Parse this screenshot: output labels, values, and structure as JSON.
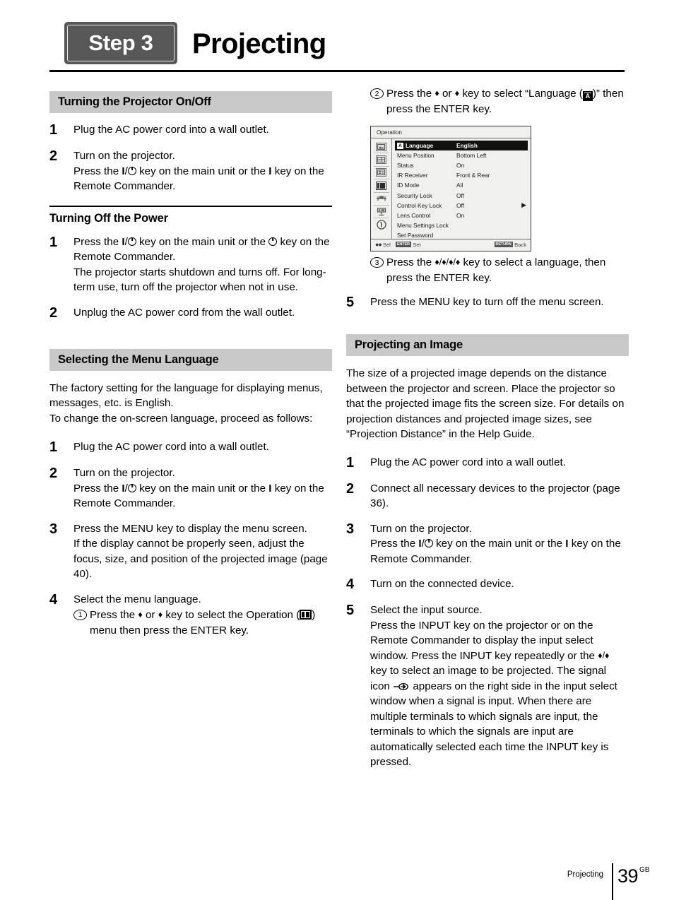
{
  "header": {
    "step_badge": "Step 3",
    "title": "Projecting"
  },
  "left_column": {
    "section1": {
      "heading": "Turning the Projector On/Off",
      "steps": [
        {
          "num": "1",
          "lines": [
            "Plug the AC power cord into a wall outlet."
          ]
        },
        {
          "num": "2",
          "lines": [
            "Turn on the projector.",
            "Press the I/⏻ key on the main unit or the I key on the Remote Commander."
          ]
        }
      ]
    },
    "subsection1": {
      "heading": "Turning Off the Power",
      "steps": [
        {
          "num": "1",
          "lines": [
            "Press the I/⏻ key on the main unit or the ⏻ key on the Remote Commander.",
            "The projector starts shutdown and turns off. For long-term use, turn off the projector when not in use."
          ]
        },
        {
          "num": "2",
          "lines": [
            "Unplug the AC power cord from the wall outlet."
          ]
        }
      ]
    },
    "section2": {
      "heading": "Selecting the Menu Language",
      "intro": [
        "The factory setting for the language for displaying menus, messages, etc. is English.",
        "To change the on-screen language, proceed as follows:"
      ],
      "steps": [
        {
          "num": "1",
          "lines": [
            "Plug the AC power cord into a wall outlet."
          ]
        },
        {
          "num": "2",
          "lines": [
            "Turn on the projector.",
            "Press the I/⏻ key on the main unit or the I key on the Remote Commander."
          ]
        },
        {
          "num": "3",
          "lines": [
            "Press the MENU key to display the menu screen.",
            "If the display cannot be properly seen, adjust the focus, size, and position of the projected image (page 40)."
          ]
        },
        {
          "num": "4",
          "lines": [
            "Select the menu language."
          ]
        }
      ],
      "substep_1": {
        "marker": "1",
        "text_a": "Press the ",
        "arrows_a": "♦",
        "text_b": " or ",
        "arrows_b": "♦",
        "text_c": " key to select the Operation (",
        "text_d": ") menu then press the ENTER key."
      }
    }
  },
  "right_column": {
    "substep_2": {
      "marker": "2",
      "text_a": "Press the ",
      "text_b": " or ",
      "text_c": " key to select “Language (",
      "text_d": ")” then press the ENTER key."
    },
    "osd": {
      "title": "Operation",
      "rows": [
        {
          "name": "Language",
          "value": "English",
          "selected": true,
          "icon": "language-icon",
          "arrow": false
        },
        {
          "name": "Menu Position",
          "value": "Bottom Left",
          "selected": false,
          "arrow": false
        },
        {
          "name": "Status",
          "value": "On",
          "selected": false,
          "arrow": false
        },
        {
          "name": "IR Receiver",
          "value": "Front & Rear",
          "selected": false,
          "arrow": false
        },
        {
          "name": "ID Mode",
          "value": "All",
          "selected": false,
          "arrow": false
        },
        {
          "name": "Security Lock",
          "value": "Off",
          "selected": false,
          "arrow": false
        },
        {
          "name": "Control Key Lock",
          "value": "Off",
          "selected": false,
          "arrow": true
        },
        {
          "name": "Lens Control",
          "value": "On",
          "selected": false,
          "arrow": false
        },
        {
          "name": "Menu Settings Lock",
          "value": "",
          "selected": false,
          "arrow": false
        },
        {
          "name": "Set Password",
          "value": "",
          "selected": false,
          "arrow": false
        }
      ],
      "rail_icons": [
        "picture-icon",
        "screen-icon",
        "function-icon",
        "operation-icon",
        "connection-power-icon",
        "installation-icon",
        "information-icon"
      ],
      "footer": {
        "sel_label": "Sel",
        "enter_key": "ENTER",
        "set_label": "Set",
        "return_key": "RETURN",
        "back_label": "Back"
      }
    },
    "substep_3": {
      "marker": "3",
      "text_a": "Press the ",
      "arrows": "♦/♦/♦/♦",
      "text_b": " key to select a language, then press the ENTER key."
    },
    "step5_top": {
      "num": "5",
      "lines": [
        "Press the MENU key to turn off the menu screen."
      ]
    },
    "section3": {
      "heading": "Projecting an Image",
      "intro": "The size of a projected image depends on the distance between the projector and screen. Place the projector so that the projected image fits the screen size. For details on projection distances and projected image sizes, see “Projection Distance” in the Help Guide.",
      "steps": [
        {
          "num": "1",
          "lines": [
            "Plug the AC power cord into a wall outlet."
          ]
        },
        {
          "num": "2",
          "lines": [
            "Connect all necessary devices to the projector (page 36)."
          ]
        },
        {
          "num": "3",
          "lines": [
            "Turn on the projector.",
            "Press the I/⏻ key on the main unit or the I key on the Remote Commander."
          ]
        },
        {
          "num": "4",
          "lines": [
            "Turn on the connected device."
          ]
        },
        {
          "num": "5",
          "lines": [
            "Select the input source."
          ]
        }
      ],
      "step5_body_a": "Press the INPUT key on the projector or on the Remote Commander to display the input select window. Press the INPUT key repeatedly or the ",
      "step5_arrows": "♦/♦",
      "step5_body_b": " key to select an image to be projected. The signal icon ",
      "step5_body_c": " appears on the right side in the input select window when a signal is input. When there are multiple terminals to which signals are input, the terminals to which the signals are input are automatically selected each time the INPUT key is pressed."
    }
  },
  "footer": {
    "section_name": "Projecting",
    "page_number": "39",
    "page_suffix": "GB"
  },
  "colors": {
    "section_bar": "#c9c9c9",
    "step_badge": "#575757",
    "osd_background": "#f0f0ee",
    "osd_selected": "#111111"
  }
}
